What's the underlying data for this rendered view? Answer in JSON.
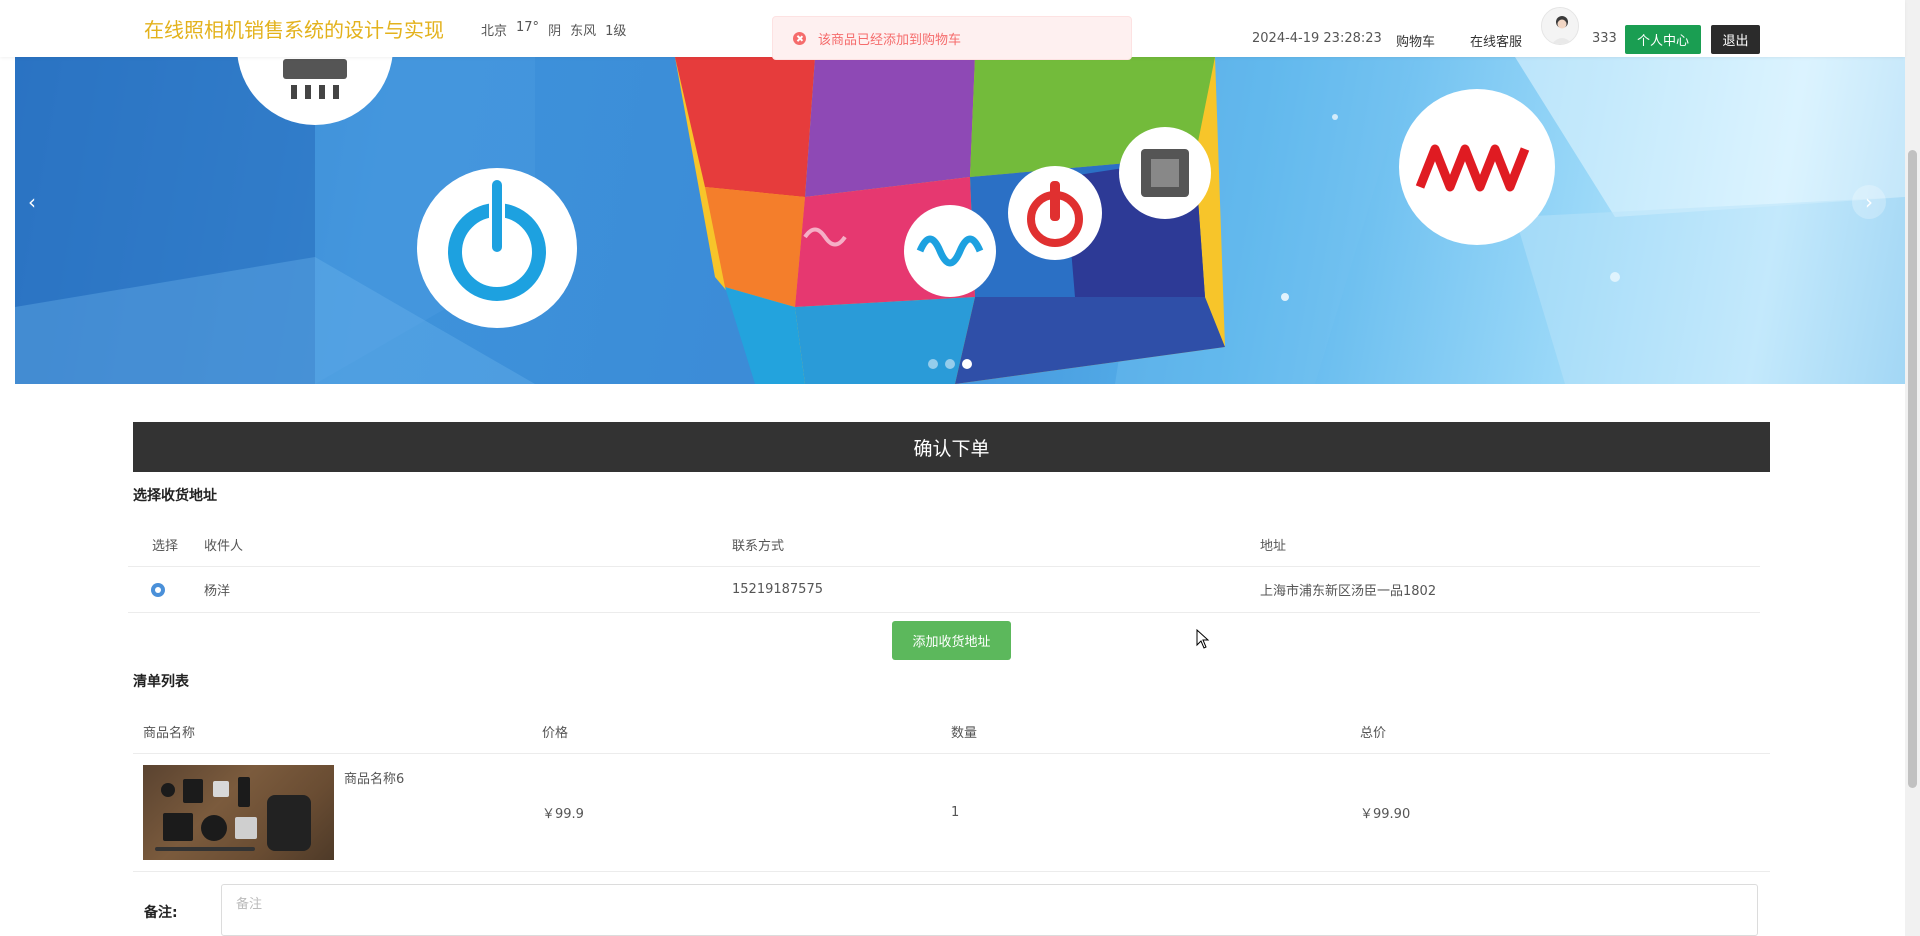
{
  "header": {
    "site_title": "在线照相机销售系统的设计与实现",
    "weather": {
      "city": "北京",
      "temp": "17°",
      "condition": "阴",
      "wind": "东风",
      "level": "1级"
    },
    "datetime": "2024-4-19 23:28:23",
    "cart_link": "购物车",
    "service_link": "在线客服",
    "username": "333",
    "center_button": "个人中心",
    "logout_button": "退出"
  },
  "toast": {
    "message": "该商品已经添加到购物车"
  },
  "banner": {
    "prev": "‹",
    "next": "›",
    "slide_count": 3,
    "active_index": 2
  },
  "order": {
    "title": "确认下单",
    "address_section_label": "选择收货地址",
    "address_columns": [
      "选择",
      "收件人",
      "联系方式",
      "地址"
    ],
    "addresses": [
      {
        "name": "杨洋",
        "phone": "15219187575",
        "address": "上海市浦东新区汤臣一品1802",
        "selected": true
      }
    ],
    "add_address_button": "添加收货地址",
    "list_section_label": "清单列表",
    "list_columns": [
      "商品名称",
      "价格",
      "数量",
      "总价"
    ],
    "items": [
      {
        "name": "商品名称6",
        "price": "￥99.9",
        "quantity": "1",
        "total": "￥99.90"
      }
    ],
    "remark_label": "备注:",
    "remark_placeholder": "备注"
  },
  "colors": {
    "title_gold": "#e3b21c",
    "center_green": "#1a9e52",
    "add_green": "#5cb85c",
    "order_bar": "#333333",
    "toast_red": "#f56c6c",
    "radio_blue": "#4a90d9"
  }
}
